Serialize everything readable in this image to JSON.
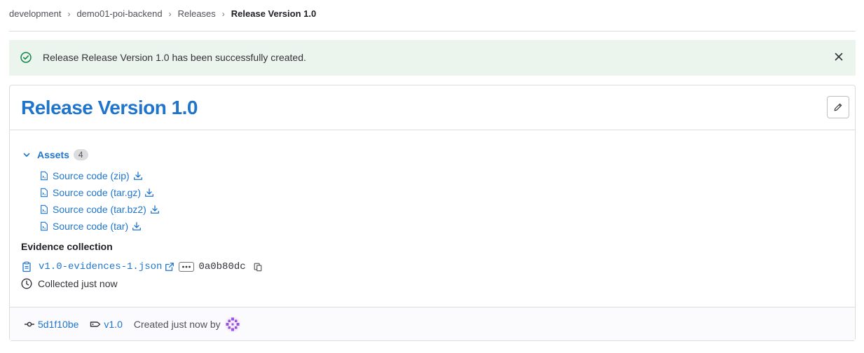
{
  "breadcrumb": {
    "items": [
      "development",
      "demo01-poi-backend",
      "Releases"
    ],
    "current": "Release Version 1.0"
  },
  "alert": {
    "message": "Release Release Version 1.0 has been successfully created.",
    "color": "#ecf4ee"
  },
  "release": {
    "title": "Release Version 1.0",
    "assets": {
      "label": "Assets",
      "count": "4",
      "items": [
        {
          "label": "Source code (zip)"
        },
        {
          "label": "Source code (tar.gz)"
        },
        {
          "label": "Source code (tar.bz2)"
        },
        {
          "label": "Source code (tar)"
        }
      ]
    },
    "evidence": {
      "heading": "Evidence collection",
      "file": "v1.0-evidences-1.json",
      "sha": "0a0b80dc",
      "collected": "Collected just now"
    },
    "footer": {
      "commit": "5d1f10be",
      "tag": "v1.0",
      "created": "Created just now by"
    }
  },
  "colors": {
    "accent": "#1f75cb",
    "success": "#108548",
    "avatar": "#9b51e0"
  }
}
